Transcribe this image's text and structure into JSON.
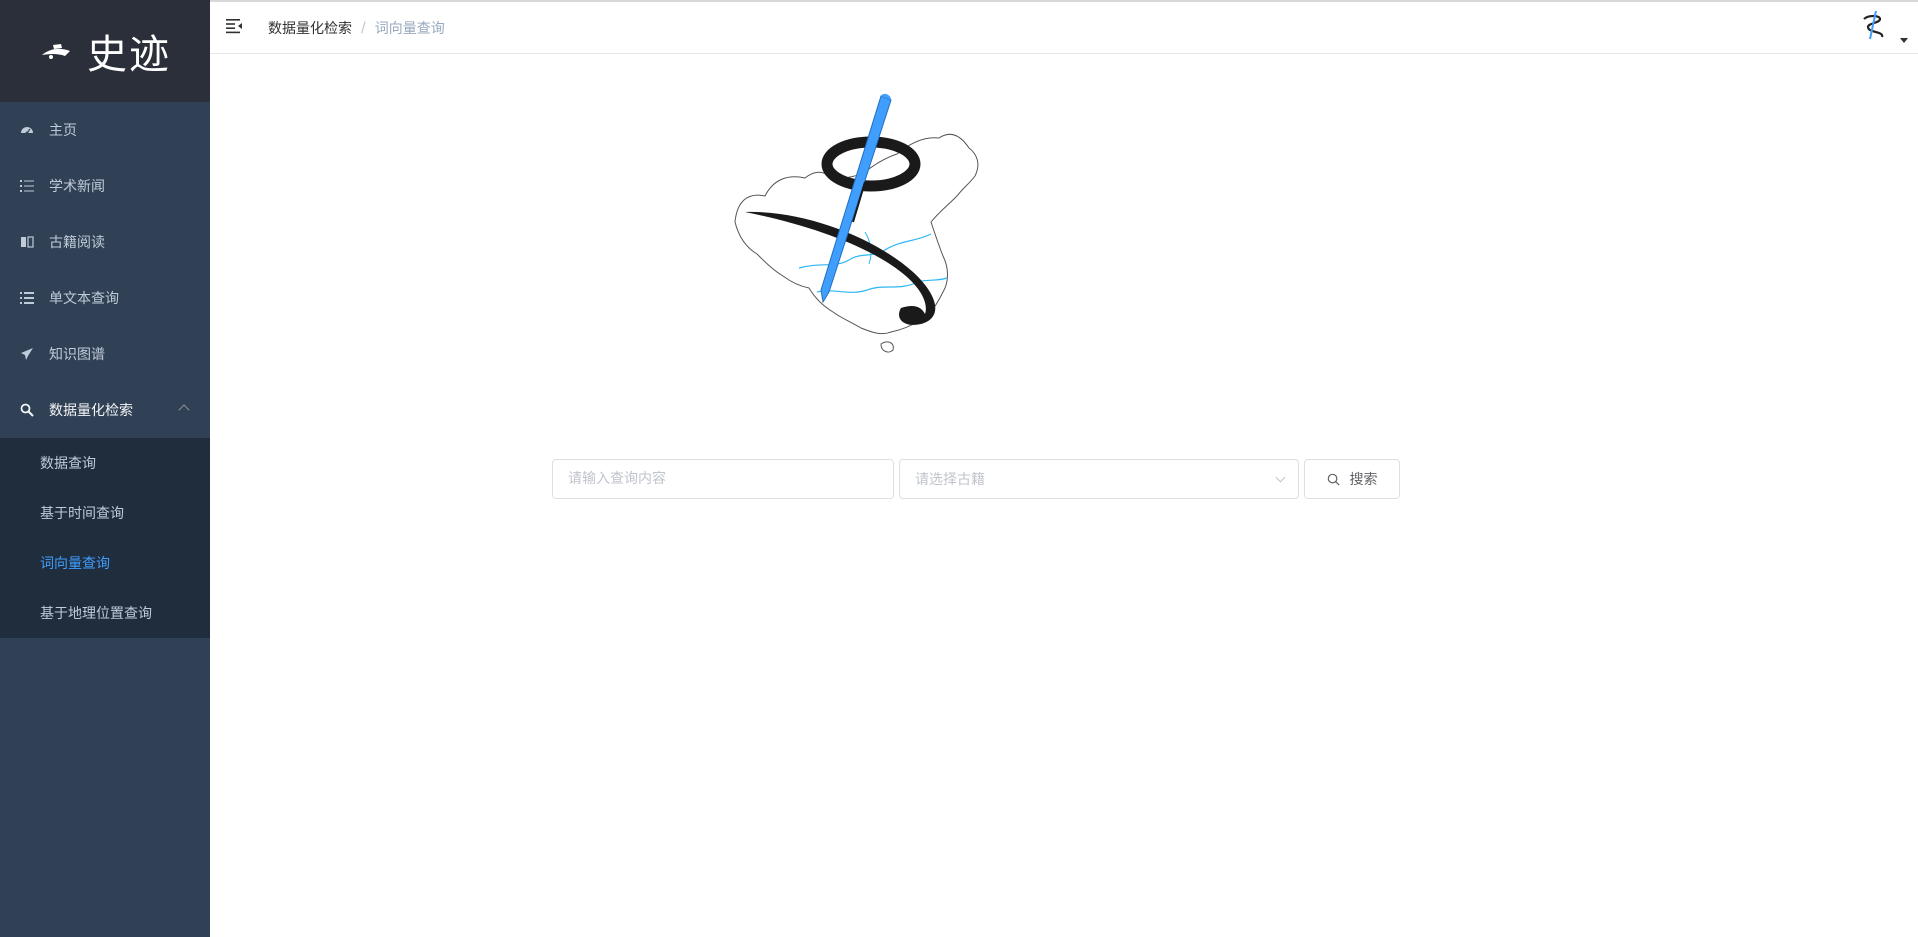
{
  "sidebar": {
    "brand": "史迹",
    "menu": [
      {
        "label": "主页",
        "icon": "dashboard-icon"
      },
      {
        "label": "学术新闻",
        "icon": "list-icon"
      },
      {
        "label": "古籍阅读",
        "icon": "book-icon"
      },
      {
        "label": "单文本查询",
        "icon": "list-icon"
      },
      {
        "label": "知识图谱",
        "icon": "paper-plane-icon"
      },
      {
        "label": "数据量化检索",
        "icon": "search-icon",
        "expanded": true
      }
    ],
    "submenu": [
      {
        "label": "数据查询"
      },
      {
        "label": "基于时间查询"
      },
      {
        "label": "词向量查询",
        "active": true
      },
      {
        "label": "基于地理位置查询"
      }
    ]
  },
  "navbar": {
    "breadcrumb": [
      "数据量化检索",
      "词向量查询"
    ],
    "separator": "/"
  },
  "search": {
    "input_placeholder": "请输入查询内容",
    "select_placeholder": "请选择古籍",
    "button_label": "搜索"
  },
  "colors": {
    "sidebar_bg": "#304156",
    "logo_bg": "#2b2f3a",
    "submenu_bg": "#1f2d3d",
    "active": "#409eff"
  }
}
